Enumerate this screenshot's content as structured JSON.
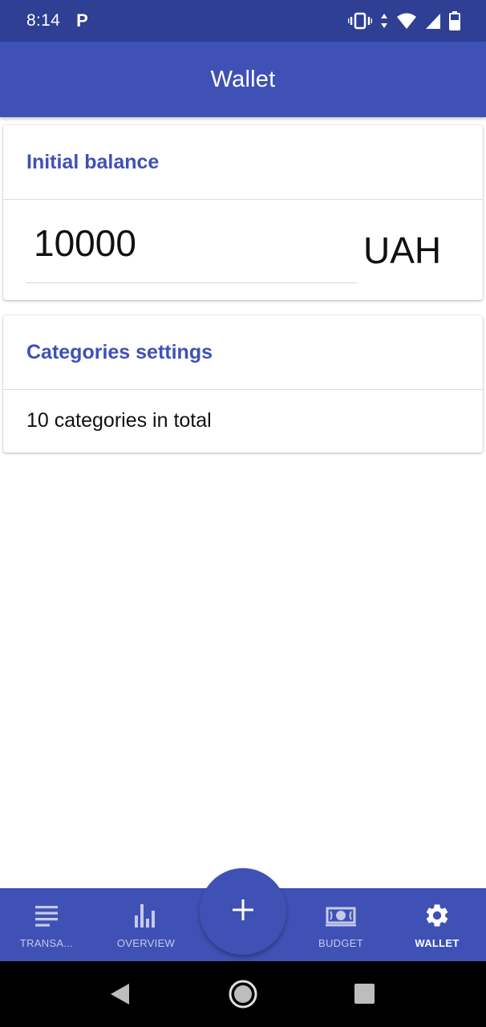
{
  "status_bar": {
    "time": "8:14",
    "notification": "P",
    "icons": [
      "vibrate-icon",
      "data-arrows-icon",
      "wifi-icon",
      "signal-icon",
      "battery-icon"
    ]
  },
  "app_bar": {
    "title": "Wallet"
  },
  "initial_balance": {
    "title": "Initial balance",
    "value": "10000",
    "currency": "UAH"
  },
  "categories": {
    "title": "Categories settings",
    "summary": "10 categories in total"
  },
  "bottom_nav": {
    "items": [
      {
        "label": "TRANSA...",
        "icon": "list-icon",
        "active": false
      },
      {
        "label": "OVERVIEW",
        "icon": "bar-chart-icon",
        "active": false
      },
      {
        "label": "BUDGET",
        "icon": "money-icon",
        "active": false
      },
      {
        "label": "WALLET",
        "icon": "gear-icon",
        "active": true
      }
    ],
    "fab_icon": "plus-icon"
  },
  "colors": {
    "primary": "#3f51b5",
    "primary_dark": "#2f3f94",
    "nav_inactive": "#c5cae9"
  }
}
